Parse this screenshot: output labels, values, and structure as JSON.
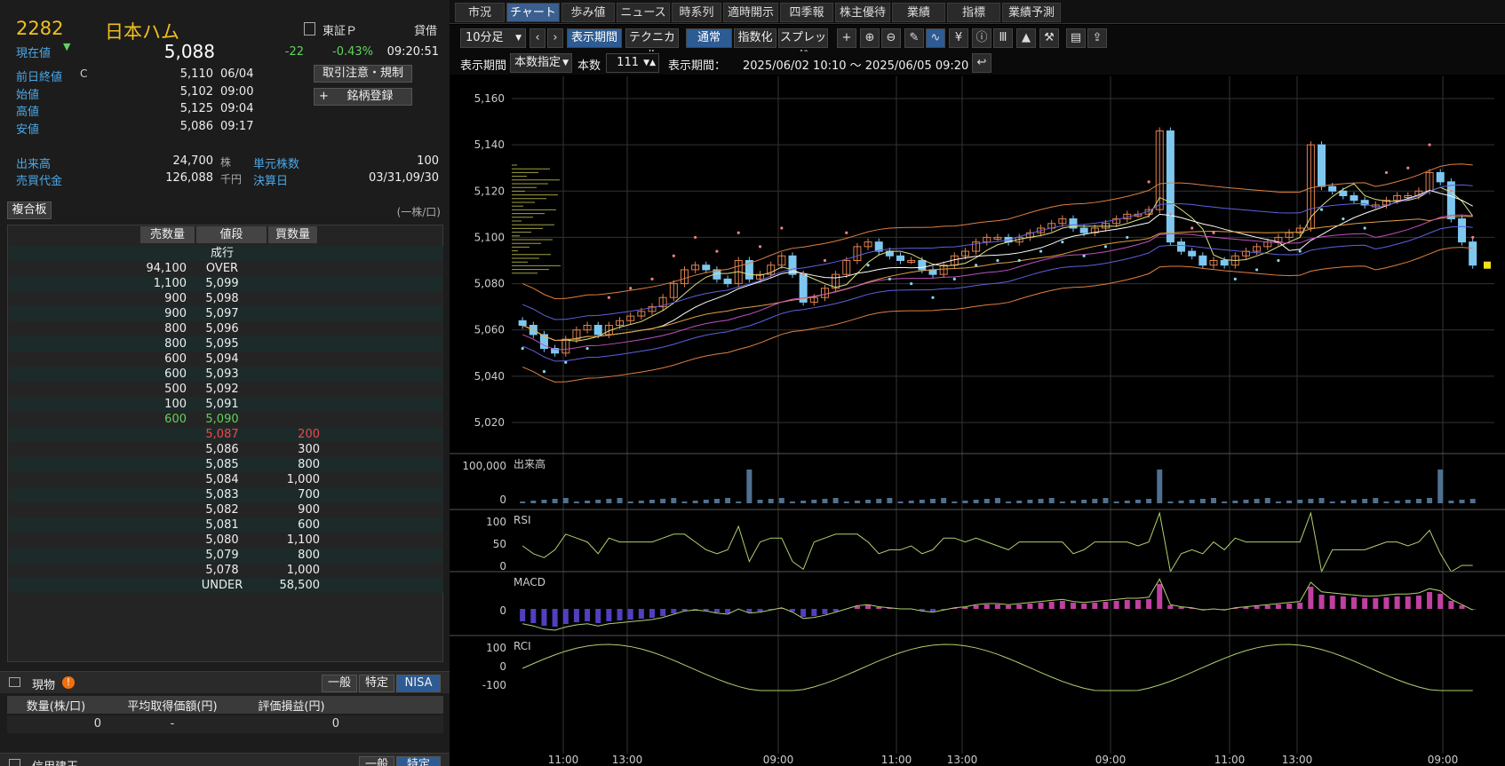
{
  "quote": {
    "code": "2282",
    "name": "日本ハム",
    "market": "東証Ｐ",
    "credit": "貸借",
    "current_label": "現在値",
    "current_price": "5,088",
    "change": "-22",
    "change_pct": "-0.43%",
    "time": "09:20:51",
    "rows": [
      {
        "label": "前日終値",
        "mark": "C",
        "value": "5,110",
        "time": "06/04"
      },
      {
        "label": "始値",
        "mark": "",
        "value": "5,102",
        "time": "09:00"
      },
      {
        "label": "高値",
        "mark": "",
        "value": "5,125",
        "time": "09:04"
      },
      {
        "label": "安値",
        "mark": "",
        "value": "5,086",
        "time": "09:17"
      }
    ],
    "volume_label": "出来高",
    "volume": "24,700",
    "volume_unit": "株",
    "turnover_label": "売買代金",
    "turnover": "126,088",
    "turnover_unit": "千円",
    "unit_label": "単元株数",
    "unit_value": "100",
    "settle_label": "決算日",
    "settle_value": "03/31,09/30",
    "btn_caution": "取引注意・規制",
    "btn_register": "銘柄登録"
  },
  "board": {
    "title": "複合板",
    "unit_note": "(一株/口)",
    "headers": [
      "売数量",
      "値段",
      "買数量"
    ],
    "rows": [
      {
        "sell": "",
        "price": "成行",
        "buy": "",
        "color": "#eee"
      },
      {
        "sell": "94,100",
        "price": "OVER",
        "buy": "",
        "color": "#eee"
      },
      {
        "sell": "1,100",
        "price": "5,099",
        "buy": "",
        "color": "#eee"
      },
      {
        "sell": "900",
        "price": "5,098",
        "buy": "",
        "color": "#eee"
      },
      {
        "sell": "900",
        "price": "5,097",
        "buy": "",
        "color": "#eee"
      },
      {
        "sell": "800",
        "price": "5,096",
        "buy": "",
        "color": "#eee"
      },
      {
        "sell": "800",
        "price": "5,095",
        "buy": "",
        "color": "#eee"
      },
      {
        "sell": "600",
        "price": "5,094",
        "buy": "",
        "color": "#eee"
      },
      {
        "sell": "600",
        "price": "5,093",
        "buy": "",
        "color": "#eee"
      },
      {
        "sell": "500",
        "price": "5,092",
        "buy": "",
        "color": "#eee"
      },
      {
        "sell": "100",
        "price": "5,091",
        "buy": "",
        "color": "#eee"
      },
      {
        "sell": "600",
        "price": "5,090",
        "buy": "",
        "color": "#5fd35f"
      },
      {
        "sell": "",
        "price": "5,087",
        "buy": "200",
        "color": "#f04848"
      },
      {
        "sell": "",
        "price": "5,086",
        "buy": "300",
        "color": "#eee"
      },
      {
        "sell": "",
        "price": "5,085",
        "buy": "800",
        "color": "#eee"
      },
      {
        "sell": "",
        "price": "5,084",
        "buy": "1,000",
        "color": "#eee"
      },
      {
        "sell": "",
        "price": "5,083",
        "buy": "700",
        "color": "#eee"
      },
      {
        "sell": "",
        "price": "5,082",
        "buy": "900",
        "color": "#eee"
      },
      {
        "sell": "",
        "price": "5,081",
        "buy": "600",
        "color": "#eee"
      },
      {
        "sell": "",
        "price": "5,080",
        "buy": "1,100",
        "color": "#eee"
      },
      {
        "sell": "",
        "price": "5,079",
        "buy": "800",
        "color": "#eee"
      },
      {
        "sell": "",
        "price": "5,078",
        "buy": "1,000",
        "color": "#eee"
      },
      {
        "sell": "",
        "price": "UNDER",
        "buy": "58,500",
        "color": "#eee"
      }
    ]
  },
  "holdings": {
    "title": "現物",
    "tabs": [
      "一般",
      "特定",
      "NISA"
    ],
    "headers": [
      "数量(株/口)",
      "平均取得価額(円)",
      "評価損益(円)"
    ],
    "values": [
      "0",
      "-",
      "0"
    ],
    "next_title": "信用建玉",
    "next_tabs": [
      "一般",
      "特定"
    ]
  },
  "tabs": [
    "市況",
    "チャート",
    "歩み値",
    "ニュース",
    "時系列",
    "適時開示",
    "四季報",
    "株主優待",
    "業績",
    "指標",
    "業績予測"
  ],
  "toolbar": {
    "interval": "10分足",
    "buttons": [
      "表示期間",
      "テクニカル",
      "通常",
      "指数化",
      "スプレッド"
    ],
    "period_label": "表示期間",
    "period_mode": "本数指定",
    "count_label": "本数",
    "count_value": "111",
    "range_label": "表示期間：",
    "range_value": "2025/06/02 10:10 〜 2025/06/05 09:20"
  },
  "chart_data": {
    "type": "candlestick",
    "y_ticks": [
      "5,160",
      "5,140",
      "5,120",
      "5,100",
      "5,080",
      "5,060",
      "5,040",
      "5,020"
    ],
    "ylim": [
      5020,
      5160
    ],
    "x_ticks": [
      "11:00",
      "13:00",
      "09:00",
      "11:00",
      "13:00",
      "09:00",
      "11:00",
      "13:00",
      "09:00"
    ],
    "closes": [
      5062,
      5058,
      5052,
      5050,
      5056,
      5060,
      5062,
      5058,
      5062,
      5064,
      5066,
      5068,
      5070,
      5074,
      5080,
      5086,
      5088,
      5086,
      5082,
      5080,
      5090,
      5082,
      5084,
      5088,
      5092,
      5084,
      5072,
      5074,
      5078,
      5084,
      5090,
      5096,
      5098,
      5094,
      5092,
      5090,
      5090,
      5086,
      5084,
      5088,
      5092,
      5094,
      5098,
      5100,
      5100,
      5098,
      5100,
      5102,
      5104,
      5106,
      5108,
      5104,
      5102,
      5104,
      5106,
      5108,
      5110,
      5110,
      5112,
      5146,
      5098,
      5094,
      5092,
      5088,
      5090,
      5088,
      5092,
      5094,
      5096,
      5098,
      5100,
      5102,
      5104,
      5140,
      5122,
      5120,
      5118,
      5116,
      5114,
      5114,
      5116,
      5118,
      5118,
      5120,
      5128,
      5124,
      5108,
      5098,
      5088
    ],
    "panels": [
      {
        "label": "出来高",
        "ticks": [
          "100,000",
          "0"
        ]
      },
      {
        "label": "RSI",
        "ticks": [
          "100",
          "50",
          "0"
        ]
      },
      {
        "label": "MACD",
        "ticks": [
          "0"
        ]
      },
      {
        "label": "RCI",
        "ticks": [
          "100",
          "0",
          "-100"
        ]
      }
    ],
    "colors": {
      "up": "#e08050",
      "down": "#7ec8f0",
      "sar_up": "#f08080",
      "sar_down": "#80d8f0"
    }
  }
}
